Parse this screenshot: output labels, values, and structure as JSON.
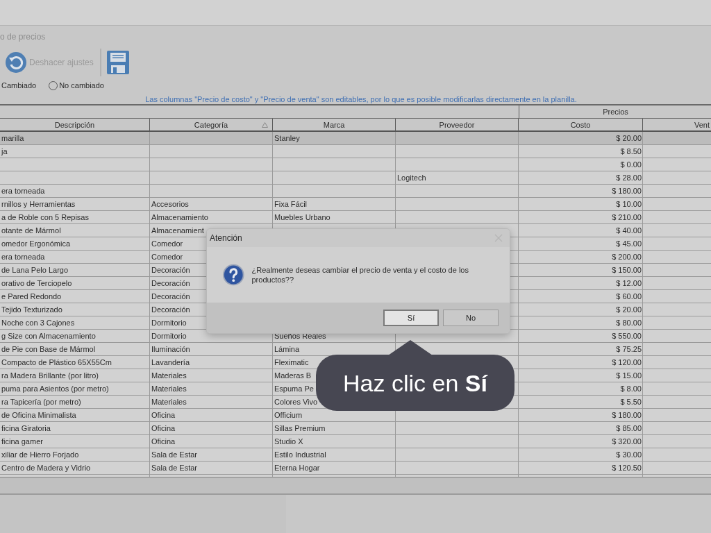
{
  "window": {
    "title": "o de precios"
  },
  "toolbar": {
    "undo": {
      "label": "Deshacer ajustes",
      "disabled": true
    }
  },
  "filters": [
    {
      "label": "Cambiado",
      "kind": "cut"
    },
    {
      "label": "No cambiado",
      "kind": "radio",
      "selected": false
    }
  ],
  "info": "Las columnas \"Precio de costo\" y \"Precio de venta\" son editables, por lo que es posible modificarlas directamente en la planilla.",
  "table": {
    "group": "Precios",
    "columns": [
      {
        "label": "Descripción",
        "sorted": false
      },
      {
        "label": "Categoría",
        "sorted": true
      },
      {
        "label": "Marca",
        "sorted": false
      },
      {
        "label": "Proveedor",
        "sorted": false
      },
      {
        "label": "Costo",
        "sorted": false
      },
      {
        "label": "Vent",
        "sorted": false
      }
    ],
    "rows": [
      {
        "cells": [
          "marilla",
          "",
          "Stanley",
          "",
          "$ 20.00",
          ""
        ],
        "selected": true
      },
      {
        "cells": [
          "ja",
          "",
          "",
          "",
          "$ 8.50",
          ""
        ],
        "selected": false
      },
      {
        "cells": [
          "",
          "",
          "",
          "",
          "$ 0.00",
          ""
        ],
        "selected": false
      },
      {
        "cells": [
          "",
          "",
          "",
          "Logitech",
          "$ 28.00",
          ""
        ],
        "selected": false
      },
      {
        "cells": [
          "era torneada",
          "",
          "",
          "",
          "$ 180.00",
          ""
        ],
        "selected": false
      },
      {
        "cells": [
          "rnillos y Herramientas",
          "Accesorios",
          "Fixa Fácil",
          "",
          "$ 10.00",
          ""
        ],
        "selected": false
      },
      {
        "cells": [
          "a de Roble con 5 Repisas",
          "Almacenamiento",
          "Muebles Urbano",
          "",
          "$ 210.00",
          ""
        ],
        "selected": false
      },
      {
        "cells": [
          "otante de Mármol",
          "Almacenamient",
          "",
          "",
          "$ 40.00",
          ""
        ],
        "selected": false
      },
      {
        "cells": [
          "omedor Ergonómica",
          "Comedor",
          "",
          "",
          "$ 45.00",
          ""
        ],
        "selected": false
      },
      {
        "cells": [
          "era torneada",
          "Comedor",
          "",
          "",
          "$ 200.00",
          ""
        ],
        "selected": false
      },
      {
        "cells": [
          "de Lana Pelo Largo",
          "Decoración",
          "",
          "",
          "$ 150.00",
          ""
        ],
        "selected": false
      },
      {
        "cells": [
          "orativo de Terciopelo",
          "Decoración",
          "",
          "",
          "$ 12.00",
          ""
        ],
        "selected": false
      },
      {
        "cells": [
          "e Pared Redondo",
          "Decoración",
          "",
          "",
          "$ 60.00",
          ""
        ],
        "selected": false
      },
      {
        "cells": [
          "Tejido Texturizado",
          "Decoración",
          "",
          "",
          "$ 20.00",
          ""
        ],
        "selected": false
      },
      {
        "cells": [
          "Noche con 3 Cajones",
          "Dormitorio",
          "",
          "",
          "$ 80.00",
          ""
        ],
        "selected": false
      },
      {
        "cells": [
          "g Size con Almacenamiento",
          "Dormitorio",
          "Sueños Reales",
          "",
          "$ 550.00",
          ""
        ],
        "selected": false
      },
      {
        "cells": [
          "de Pie con Base de Mármol",
          "Iluminación",
          "Lámina",
          "",
          "$ 75.25",
          ""
        ],
        "selected": false
      },
      {
        "cells": [
          "Compacto de Plástico 65X55Cm",
          "Lavandería",
          "Fleximatic",
          "",
          "$ 120.00",
          ""
        ],
        "selected": false
      },
      {
        "cells": [
          "ra Madera Brillante (por litro)",
          "Materiales",
          "Maderas B",
          "",
          "$ 15.00",
          ""
        ],
        "selected": false
      },
      {
        "cells": [
          "puma para Asientos (por metro)",
          "Materiales",
          "Espuma Pe",
          "",
          "$ 8.00",
          ""
        ],
        "selected": false
      },
      {
        "cells": [
          "ra Tapicería (por metro)",
          "Materiales",
          "Colores Vivo",
          "",
          "$ 5.50",
          ""
        ],
        "selected": false
      },
      {
        "cells": [
          "de Oficina Minimalista",
          "Oficina",
          "Officium",
          "",
          "$ 180.00",
          ""
        ],
        "selected": false
      },
      {
        "cells": [
          "ficina Giratoria",
          "Oficina",
          "Sillas Premium",
          "",
          "$ 85.00",
          ""
        ],
        "selected": false
      },
      {
        "cells": [
          "ficina gamer",
          "Oficina",
          "Studio X",
          "",
          "$ 320.00",
          ""
        ],
        "selected": false
      },
      {
        "cells": [
          "xiliar de Hierro Forjado",
          "Sala de Estar",
          "Estilo Industrial",
          "",
          "$ 30.00",
          ""
        ],
        "selected": false
      },
      {
        "cells": [
          "Centro de Madera y Vidrio",
          "Sala de Estar",
          "Eterna Hogar",
          "",
          "$ 120.50",
          ""
        ],
        "selected": false
      }
    ]
  },
  "dialog": {
    "title": "Atención",
    "message": "¿Realmente deseas cambiar el precio de venta y el costo de los productos??",
    "buttons": [
      {
        "label": "Sí",
        "selected": true
      },
      {
        "label": "No",
        "selected": false
      }
    ]
  },
  "tooltip": "Haz clic en **Sí**"
}
